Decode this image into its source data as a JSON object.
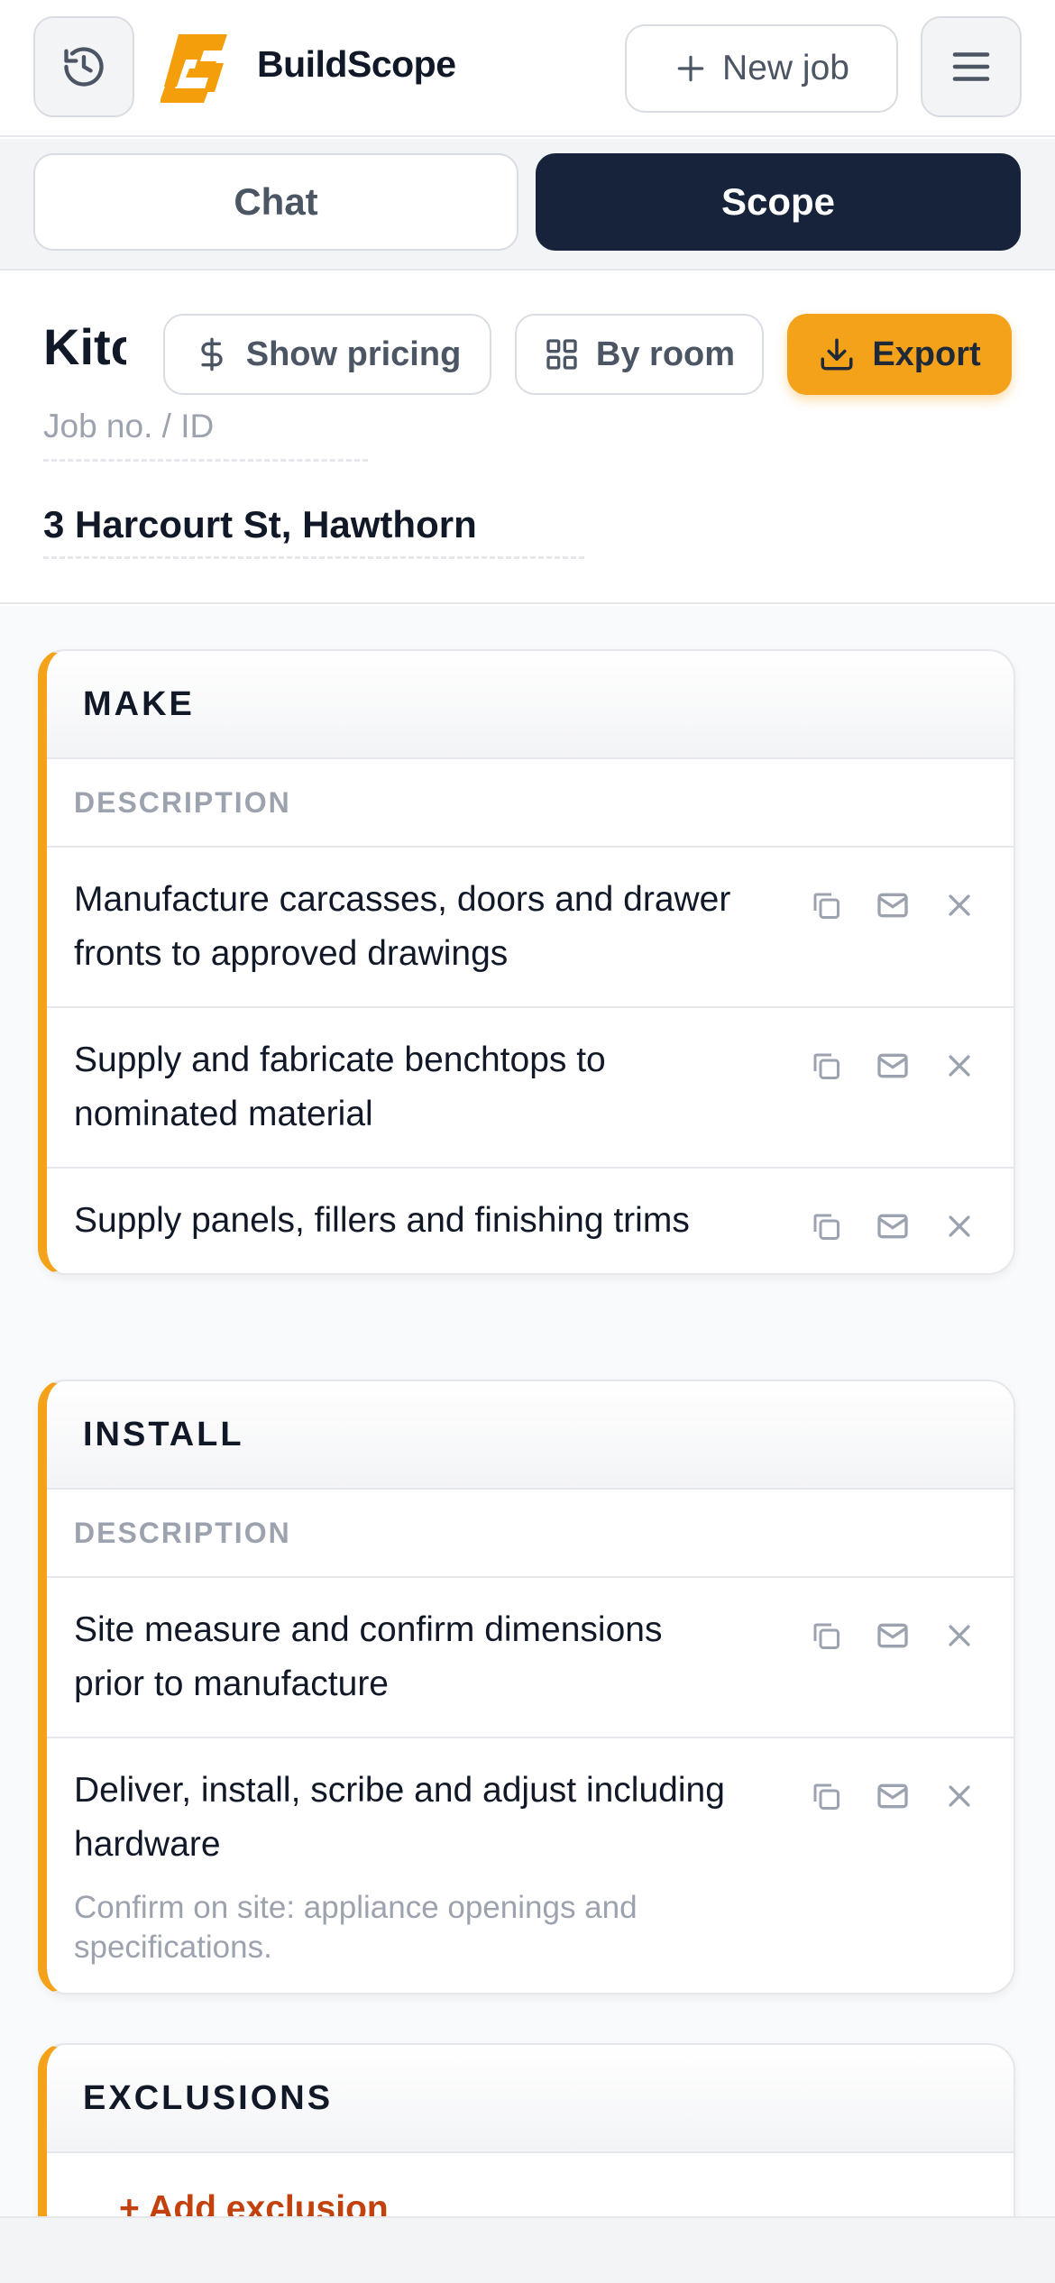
{
  "header": {
    "brand": "BuildScope",
    "new_job_label": "New job",
    "icons": [
      "history-icon",
      "brand-logo",
      "plus-icon",
      "menu-icon"
    ]
  },
  "tabs": [
    {
      "label": "Chat",
      "active": false
    },
    {
      "label": "Scope",
      "active": true
    }
  ],
  "job": {
    "title": "Kitchen",
    "job_no_placeholder": "Job no. / ID",
    "address": "3 Harcourt St, Hawthorn",
    "show_pricing_label": "Show pricing",
    "by_room_label": "By room",
    "export_label": "Export"
  },
  "sections": [
    {
      "title": "MAKE",
      "column_header": "DESCRIPTION",
      "items": [
        {
          "text": "Manufacture carcasses, doors and drawer fronts to approved drawings"
        },
        {
          "text": "Supply and fabricate benchtops to nominated material"
        },
        {
          "text": "Supply panels, fillers and finishing trims"
        }
      ]
    },
    {
      "title": "INSTALL",
      "column_header": "DESCRIPTION",
      "items": [
        {
          "text": "Site measure and confirm dimensions prior to manufacture"
        },
        {
          "text": "Deliver, install, scribe and adjust including hardware",
          "note": "Confirm on site: appliance openings and specifications."
        }
      ]
    },
    {
      "title": "EXCLUSIONS",
      "add_label": "+ Add exclusion"
    }
  ],
  "colors": {
    "accent": "#f5a21b",
    "dark": "#16233a",
    "muted": "#9ca3af"
  }
}
